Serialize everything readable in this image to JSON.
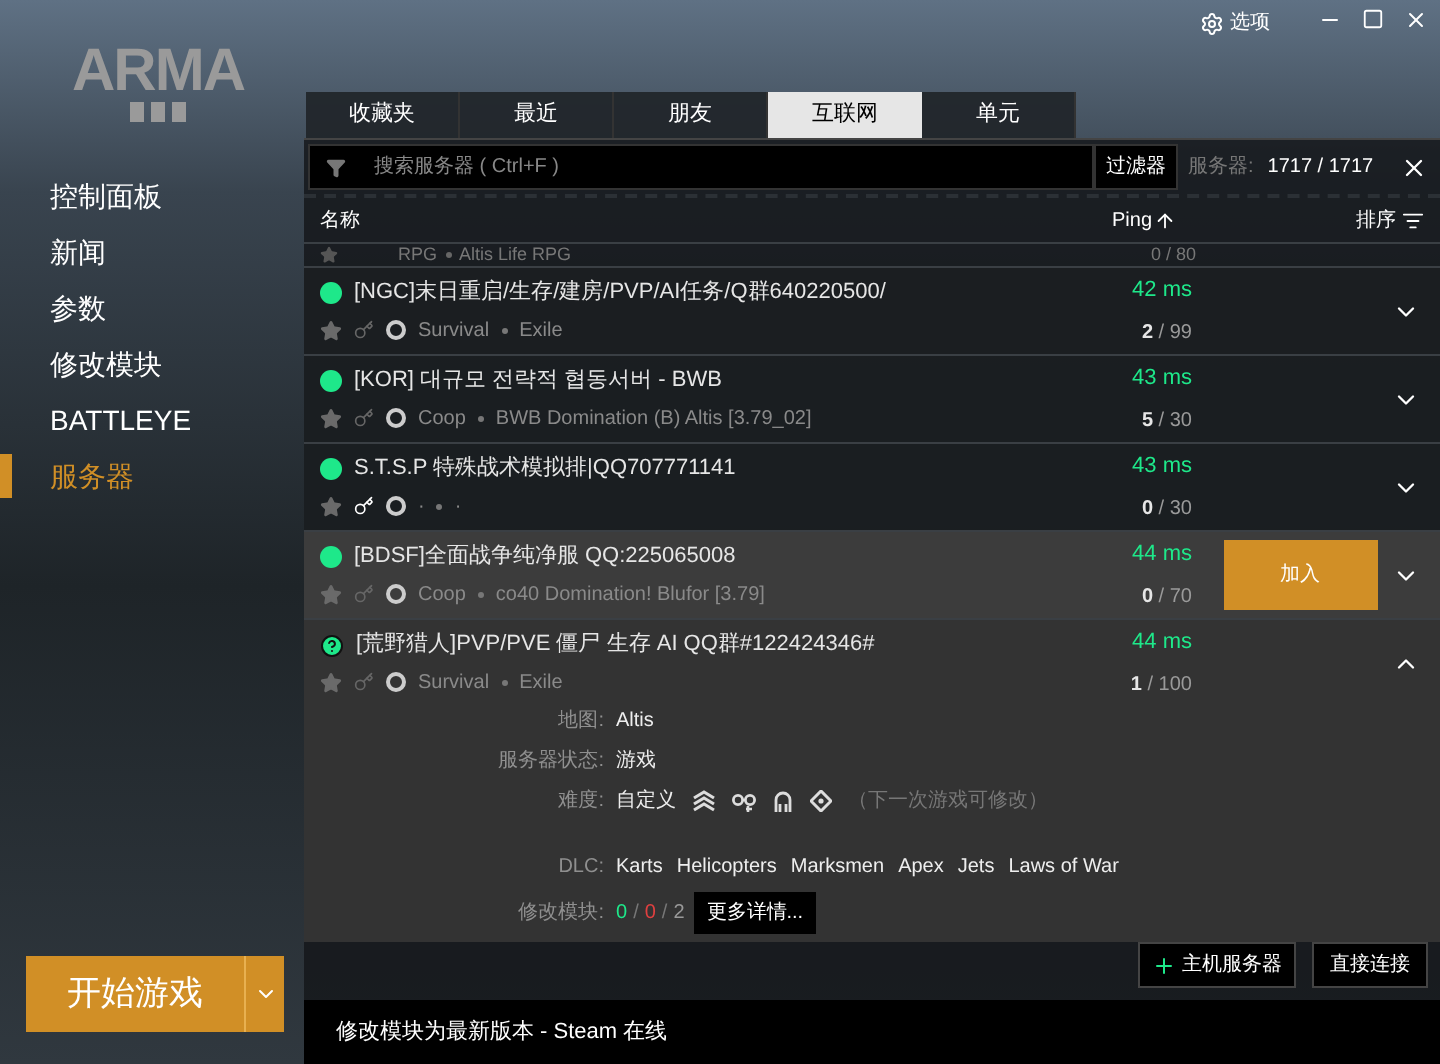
{
  "top_bar": {
    "options": "选项"
  },
  "logo": "ARMA",
  "sidebar": {
    "items": [
      {
        "label": "控制面板",
        "selected": false
      },
      {
        "label": "新闻",
        "selected": false
      },
      {
        "label": "参数",
        "selected": false
      },
      {
        "label": "修改模块",
        "selected": false
      },
      {
        "label": "BATTLEYE",
        "selected": false
      },
      {
        "label": "服务器",
        "selected": true
      }
    ]
  },
  "play_button": "开始游戏",
  "tabs": [
    {
      "label": "收藏夹",
      "selected": false
    },
    {
      "label": "最近",
      "selected": false
    },
    {
      "label": "朋友",
      "selected": false
    },
    {
      "label": "互联网",
      "selected": true
    },
    {
      "label": "单元",
      "selected": false
    }
  ],
  "search": {
    "placeholder": "搜索服务器 ( Ctrl+F )",
    "filter_button": "过滤器",
    "count_label": "服务器:",
    "count": "1717 / 1717"
  },
  "columns": {
    "name": "名称",
    "ping": "Ping",
    "sort": "排序"
  },
  "partial_row": {
    "mode": "RPG",
    "mission": "Altis Life RPG",
    "players": "0 / 80"
  },
  "servers": [
    {
      "kind": "online",
      "name": "[NGC]末日重启/生存/建房/PVP/AI任务/Q群640220500/",
      "ping": "42 ms",
      "locked": false,
      "mode": "Survival",
      "mission": "Exile",
      "players": "**2** / 99",
      "hovered": false,
      "expanded": false
    },
    {
      "kind": "online",
      "name": "[KOR] 대규모 전략적 협동서버 - BWB",
      "ping": "43 ms",
      "locked": false,
      "mode": "Coop",
      "mission": "BWB Domination (B) Altis [3.79_02]",
      "players": "**5** / 30",
      "hovered": false,
      "expanded": false
    },
    {
      "kind": "online",
      "name": "S.T.S.P 特殊战术模拟排|QQ707771141",
      "ping": "43 ms",
      "locked": true,
      "mode": "·",
      "mission": "·",
      "players": "**0** / 30",
      "hovered": false,
      "expanded": false
    },
    {
      "kind": "online",
      "name": "[BDSF]全面战争纯净服 QQ:225065008",
      "ping": "44 ms",
      "locked": false,
      "mode": "Coop",
      "mission": "co40 Domination! Blufor [3.79]",
      "players": "**0** / 70",
      "hovered": true,
      "join": "加入",
      "expanded": false
    },
    {
      "kind": "unknown",
      "name": "[荒野猎人]PVP/PVE 僵尸 生存  AI QQ群#122424346#",
      "ping": "44 ms",
      "locked": false,
      "mode": "Survival",
      "mission": "Exile",
      "players": "**1** / 100",
      "hovered": false,
      "expanded": true,
      "details": {
        "map_label": "地图:",
        "map": "Altis",
        "state_label": "服务器状态:",
        "state": "游戏",
        "difficulty_label": "难度:",
        "difficulty": "自定义",
        "difficulty_note": "（下一次游戏可修改）",
        "dlc_label": "DLC:",
        "dlc": [
          "Karts",
          "Helicopters",
          "Marksmen",
          "Apex",
          "Jets",
          "Laws of War"
        ],
        "mods_label": "修改模块:",
        "mods": [
          {
            "text": "0",
            "color": "#1ee88a"
          },
          {
            "text": "/",
            "color": "#777777"
          },
          {
            "text": "0",
            "color": "#e04040"
          },
          {
            "text": "/",
            "color": "#777777"
          },
          {
            "text": "2",
            "color": "#999999"
          }
        ],
        "more_button": "更多详情..."
      }
    }
  ],
  "footer": {
    "host_button": "主机服务器",
    "direct_button": "直接连接"
  },
  "status_bar": "修改模块为最新版本 - Steam 在线"
}
